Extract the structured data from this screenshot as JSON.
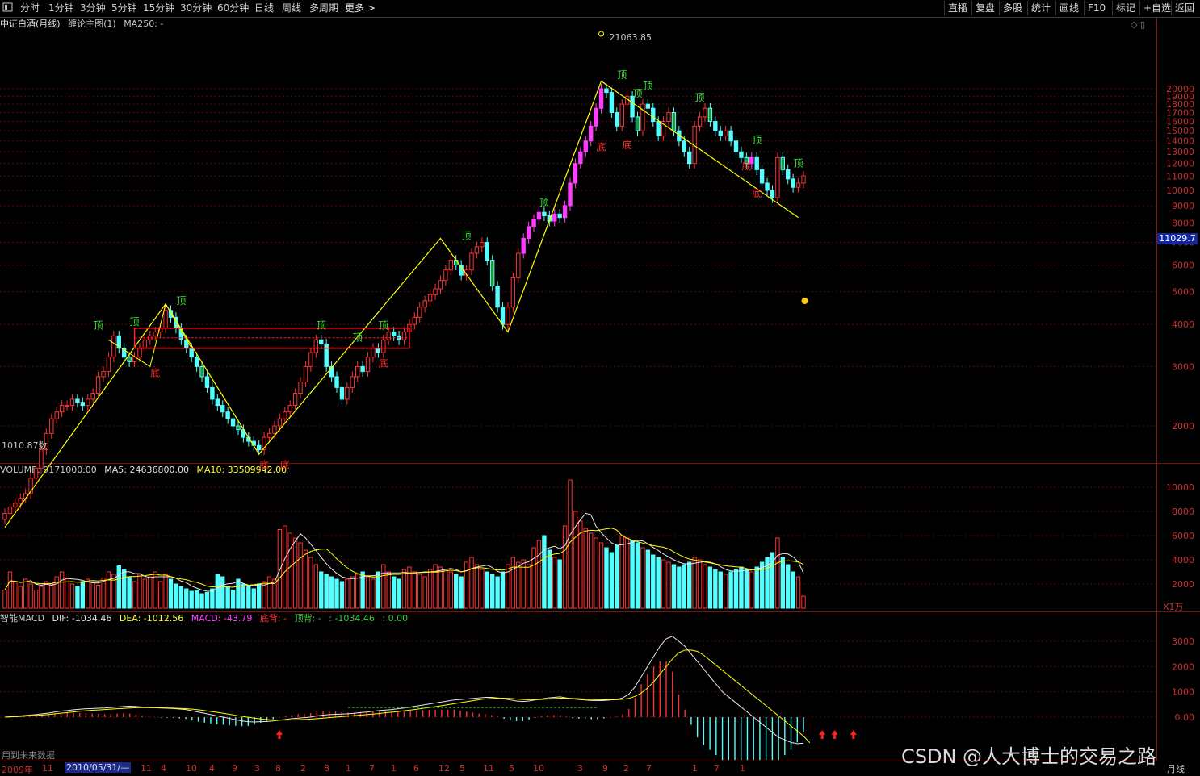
{
  "toolbar": {
    "timeframes": [
      "分时",
      "1分钟",
      "3分钟",
      "5分钟",
      "15分钟",
      "30分钟",
      "60分钟",
      "日线",
      "周线",
      "多周期"
    ],
    "more": "更多 >",
    "right_buttons": [
      "直播",
      "复盘",
      "多股",
      "统计",
      "画线",
      "F10",
      "标记",
      "+自选",
      "返回"
    ]
  },
  "main_panel": {
    "title": "中证白酒(月线)",
    "indicator": "缠论主图(1)",
    "ma_label": "MA250: -",
    "current_price": "11029.7",
    "peak_label": "21063.85",
    "low_label": "1010.87",
    "low_label_extra": "数"
  },
  "volume_panel": {
    "label": "VOLUME: 9171000.00",
    "ma5": "MA5: 24636800.00",
    "ma10": "MA10: 33509942.00",
    "unit": "X1万"
  },
  "macd_panel": {
    "name": "智能MACD",
    "dif": "DIF: -1034.46",
    "dea": "DEA: -1012.56",
    "macd": "MACD: -43.79",
    "bottom_div": "底背: -",
    "top_div": "顶背: -",
    "extra1": ": -1034.46",
    "extra2": ": 0.00",
    "footnote": "用到未来数据"
  },
  "date_axis": {
    "labels": [
      "2009年",
      "11",
      "2010/05/31/—",
      "11",
      "4",
      "10",
      "4",
      "9",
      "3",
      "8",
      "2",
      "8",
      "1",
      "7",
      "1",
      "6",
      "12",
      "5",
      "11",
      "5",
      "10",
      "3",
      "9",
      "2",
      "7",
      "1",
      "7",
      "1"
    ],
    "period": "月线"
  },
  "watermark": "CSDN @人大博士的交易之路",
  "colors": {
    "up": "#ff3232",
    "down": "#54ffff",
    "down_fill": "#1f9a3a",
    "purple": "#ff3cff",
    "yellow": "#ffff00",
    "grid": "#5a0a0a"
  },
  "chart_data": {
    "type": "candlestick",
    "price_axis": {
      "ticks": [
        2000,
        3000,
        4000,
        5000,
        6000,
        7000,
        8000,
        9000,
        10000,
        11000,
        12000,
        13000,
        14000,
        15000,
        16000,
        17000,
        18000,
        19000,
        20000
      ],
      "scale": "log"
    },
    "volume_axis": {
      "ticks": [
        2000,
        4000,
        6000,
        8000,
        10000
      ]
    },
    "macd_axis": {
      "ticks": [
        0,
        1000,
        2000,
        3000
      ],
      "tick_labels": [
        "0.00",
        "1000",
        "2000",
        "3000"
      ]
    },
    "annotations": {
      "top": "顶",
      "bottom": "底"
    },
    "close": [
      1100,
      1150,
      1180,
      1220,
      1260,
      1400,
      1500,
      1700,
      1900,
      2100,
      2200,
      2300,
      2300,
      2400,
      2350,
      2300,
      2400,
      2500,
      2800,
      2900,
      3200,
      3700,
      3400,
      3200,
      3100,
      3200,
      3400,
      3600,
      3700,
      3800,
      3900,
      4400,
      4200,
      3900,
      3600,
      3400,
      3200,
      3000,
      2800,
      2600,
      2400,
      2300,
      2200,
      2100,
      2000,
      1950,
      1850,
      1800,
      1750,
      1700,
      1850,
      1900,
      2000,
      2100,
      2200,
      2300,
      2500,
      2700,
      3000,
      3300,
      3600,
      3500,
      3000,
      2800,
      2600,
      2400,
      2600,
      2800,
      3000,
      2900,
      3200,
      3400,
      3300,
      3600,
      3800,
      3700,
      3600,
      3800,
      4000,
      4200,
      4500,
      4700,
      4900,
      5100,
      5400,
      5800,
      6200,
      6000,
      5600,
      5800,
      6500,
      6800,
      7000,
      6200,
      5200,
      4500,
      4000,
      4500,
      5500,
      6500,
      7200,
      7800,
      8200,
      8600,
      8400,
      8100,
      8500,
      8300,
      9000,
      10500,
      12000,
      13000,
      14000,
      15500,
      17500,
      20000,
      19500,
      17000,
      15500,
      18000,
      19000,
      16500,
      15000,
      18000,
      17500,
      16000,
      14500,
      16000,
      17000,
      15000,
      14000,
      13000,
      12000,
      15500,
      16500,
      17500,
      16000,
      15000,
      14500,
      15000,
      14000,
      13000,
      12500,
      12000,
      12500,
      11500,
      10500,
      10000,
      9500,
      12500,
      11500,
      10800,
      10200,
      10500,
      11029.7
    ],
    "volume": [
      1500,
      3000,
      2200,
      1800,
      2400,
      2000,
      1500,
      1800,
      2200,
      2000,
      2600,
      3000,
      2500,
      2000,
      1800,
      2200,
      2400,
      2100,
      1900,
      2500,
      3000,
      2800,
      3500,
      3200,
      2600,
      2200,
      2800,
      2400,
      2600,
      3000,
      2200,
      2800,
      2400,
      2000,
      1800,
      1600,
      1400,
      1500,
      1200,
      1300,
      1600,
      2800,
      2600,
      1800,
      1500,
      2400,
      2000,
      1800,
      1600,
      2000,
      2200,
      2600,
      2400,
      6500,
      6800,
      6200,
      5800,
      5400,
      4800,
      4200,
      3600,
      3000,
      2800,
      2600,
      2400,
      2200,
      2400,
      2600,
      2800,
      3000,
      2600,
      2400,
      3000,
      3600,
      3000,
      2600,
      2400,
      3200,
      3400,
      3000,
      2800,
      2600,
      3200,
      3600,
      3400,
      3200,
      3000,
      2800,
      2600,
      3800,
      4200,
      3600,
      3200,
      3000,
      2800,
      2600,
      3000,
      3600,
      4200,
      3800,
      4000,
      3600,
      5000,
      5600,
      6000,
      4800,
      4200,
      4000,
      6800,
      10600,
      8000,
      7200,
      6600,
      6200,
      5800,
      5400,
      5000,
      4600,
      5200,
      6000,
      5800,
      5600,
      5400,
      5000,
      4800,
      4400,
      4200,
      4000,
      3800,
      3600,
      3400,
      3600,
      3800,
      4200,
      4000,
      3600,
      3400,
      3200,
      3000,
      2800,
      3000,
      3200,
      3400,
      3200,
      3000,
      3400,
      3800,
      4200,
      4600,
      5800,
      4200,
      3600,
      3000,
      2600,
      1000
    ],
    "dif": [
      0,
      20,
      40,
      60,
      80,
      100,
      130,
      160,
      200,
      240,
      260,
      290,
      310,
      330,
      340,
      350,
      360,
      380,
      400,
      420,
      430,
      420,
      400,
      380,
      370,
      360,
      350,
      340,
      320,
      300,
      250,
      200,
      150,
      100,
      50,
      0,
      -50,
      -100,
      -150,
      -180,
      -190,
      -180,
      -170,
      -150,
      -120,
      -90,
      -60,
      -40,
      -20,
      0,
      50,
      80,
      100,
      110,
      120,
      130,
      150,
      180,
      200,
      230,
      260,
      280,
      300,
      330,
      360,
      400,
      440,
      480,
      520,
      560,
      600,
      640,
      680,
      700,
      720,
      740,
      760,
      780,
      780,
      760,
      720,
      680,
      640,
      620,
      640,
      680,
      720,
      760,
      780,
      800,
      760,
      720,
      700,
      680,
      660,
      650,
      660,
      680,
      700,
      760,
      900,
      1200,
      1600,
      2000,
      2400,
      2800,
      3100,
      3200,
      3000,
      2800,
      2500,
      2200,
      1900,
      1600,
      1300,
      1000,
      800,
      600,
      400,
      200,
      0,
      -200,
      -400,
      -600,
      -800,
      -900,
      -1000,
      -1050,
      -1034.46
    ],
    "dea": [
      0,
      10,
      20,
      35,
      50,
      65,
      85,
      105,
      130,
      155,
      180,
      205,
      230,
      250,
      270,
      285,
      300,
      315,
      330,
      345,
      360,
      370,
      375,
      375,
      372,
      368,
      362,
      355,
      345,
      335,
      315,
      290,
      260,
      225,
      190,
      150,
      110,
      70,
      30,
      -5,
      -40,
      -70,
      -95,
      -110,
      -115,
      -115,
      -110,
      -100,
      -90,
      -80,
      -60,
      -40,
      -20,
      0,
      20,
      40,
      60,
      80,
      100,
      120,
      145,
      170,
      195,
      220,
      250,
      280,
      310,
      345,
      380,
      415,
      450,
      490,
      530,
      570,
      610,
      650,
      690,
      720,
      740,
      750,
      750,
      740,
      720,
      700,
      690,
      690,
      700,
      720,
      740,
      750,
      750,
      740,
      730,
      715,
      700,
      690,
      685,
      685,
      690,
      705,
      740,
      820,
      950,
      1150,
      1400,
      1700,
      2000,
      2300,
      2550,
      2650,
      2650,
      2600,
      2450,
      2250,
      2050,
      1850,
      1650,
      1450,
      1250,
      1050,
      850,
      650,
      450,
      250,
      50,
      -150,
      -350,
      -550,
      -750,
      -1012.56
    ]
  }
}
